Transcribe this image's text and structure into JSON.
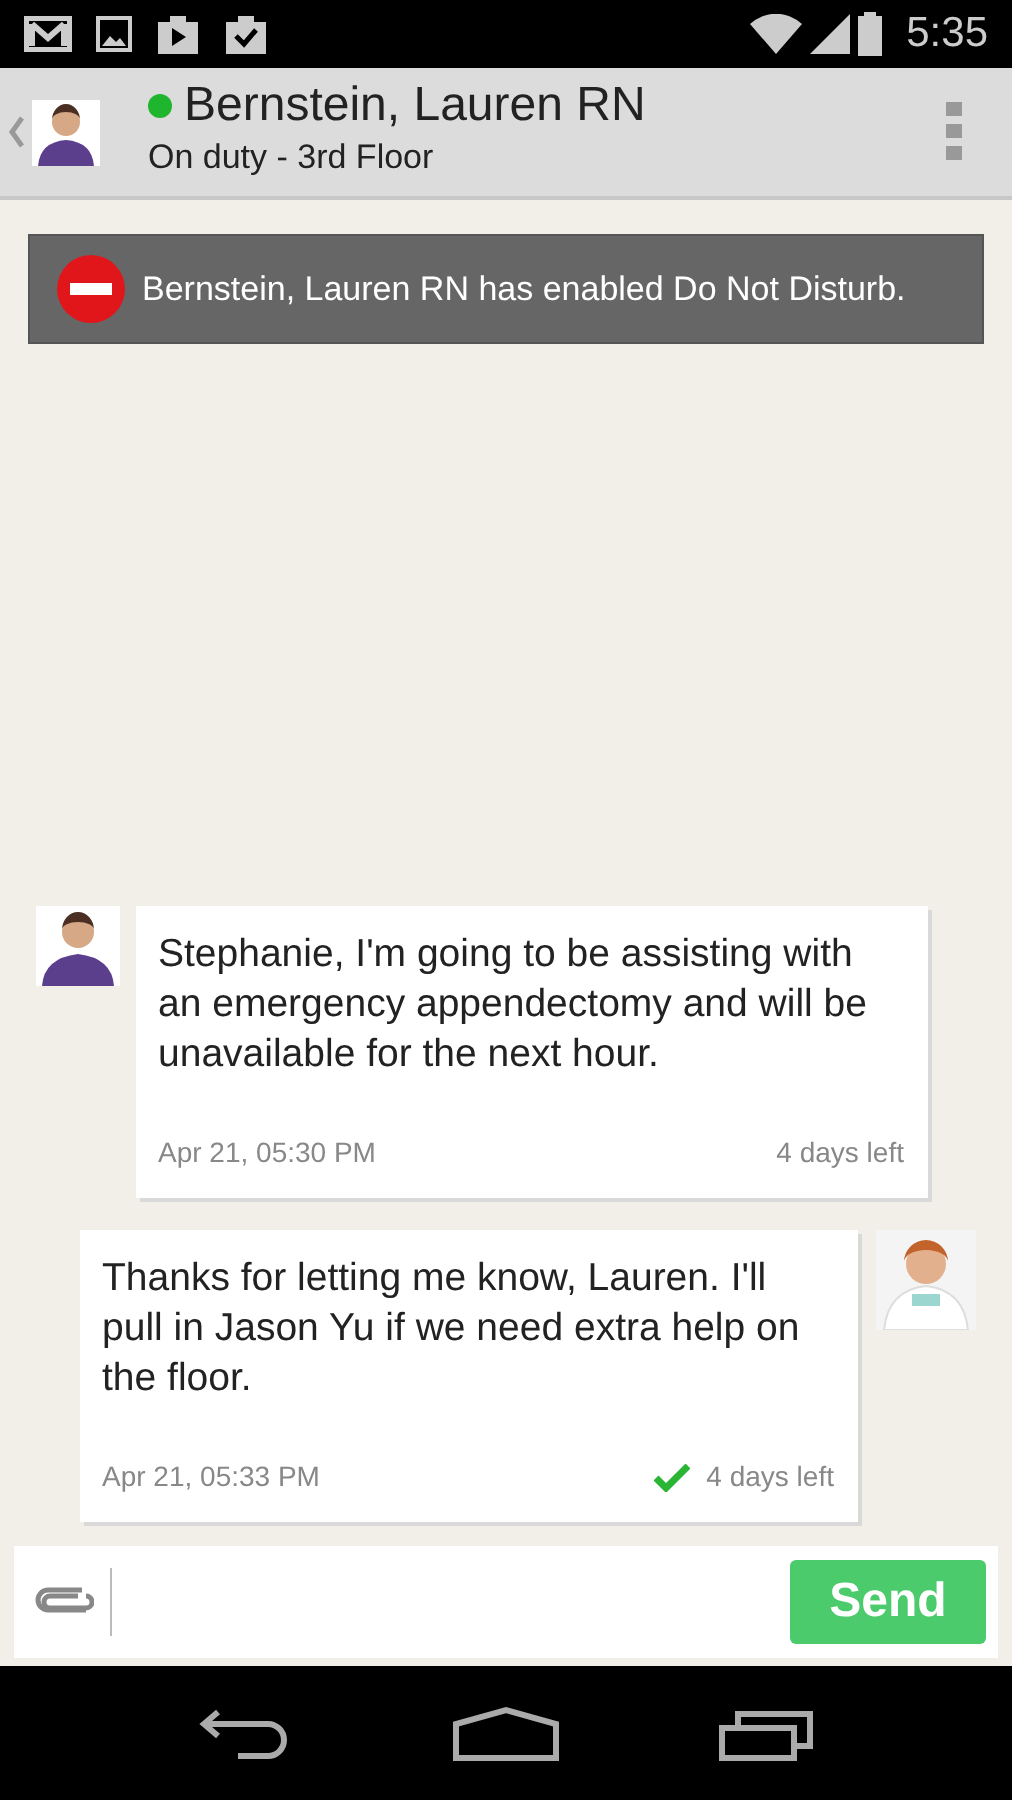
{
  "status_bar": {
    "time": "5:35"
  },
  "header": {
    "name": "Bernstein, Lauren RN",
    "status": "On duty - 3rd Floor",
    "online": true
  },
  "banner": {
    "text": "Bernstein, Lauren RN has enabled Do Not Disturb."
  },
  "messages": [
    {
      "text": "Stephanie, I'm going to be assisting with an emergency appendectomy and will be unavailable for the next hour.",
      "time": "Apr 21, 05:30 PM",
      "expiry": "4 days left",
      "outgoing": false,
      "delivered": false
    },
    {
      "text": "Thanks for letting me know, Lauren. I'll pull in Jason Yu if we need extra help on the floor.",
      "time": "Apr 21, 05:33 PM",
      "expiry": "4 days left",
      "outgoing": true,
      "delivered": true
    }
  ],
  "composer": {
    "button": "Send"
  }
}
